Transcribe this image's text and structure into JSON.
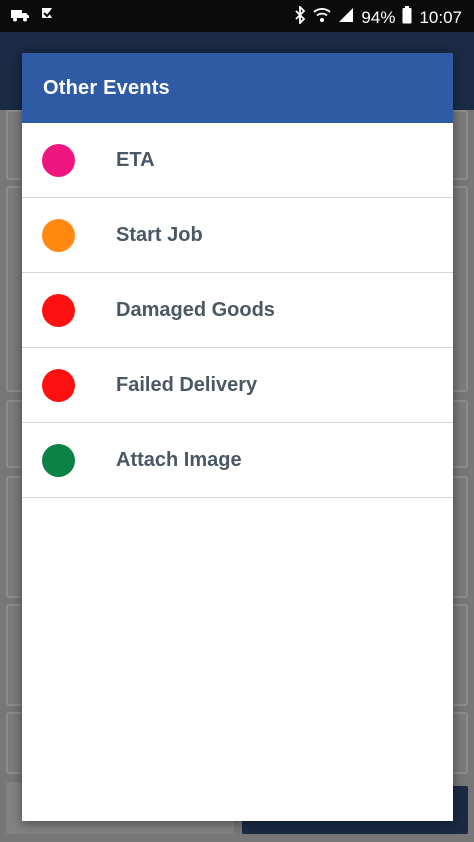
{
  "status_bar": {
    "battery": "94%",
    "time": "10:07",
    "icons": [
      "truck-icon",
      "check-flag-icon",
      "bluetooth-icon",
      "wifi-icon",
      "signal-icon",
      "battery-icon"
    ]
  },
  "dialog": {
    "title": "Other Events",
    "header_color": "#2f5aa4",
    "events": [
      {
        "label": "ETA",
        "color": "#f0167f"
      },
      {
        "label": "Start Job",
        "color": "#ff8811"
      },
      {
        "label": "Damaged Goods",
        "color": "#ff1010"
      },
      {
        "label": "Failed Delivery",
        "color": "#ff1010"
      },
      {
        "label": "Attach Image",
        "color": "#0a8243"
      }
    ]
  }
}
